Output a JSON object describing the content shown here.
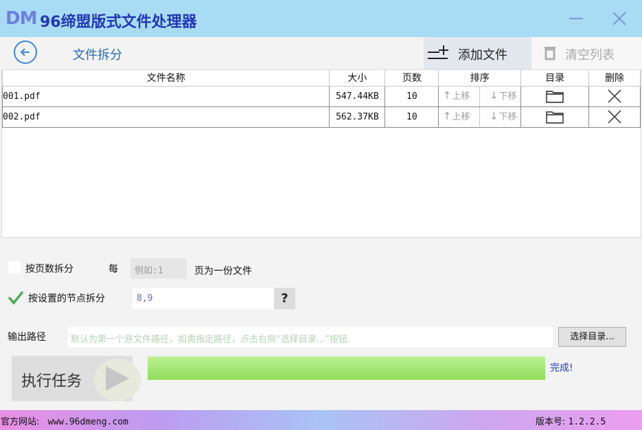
{
  "app": {
    "logo": "DM",
    "title": "96缔盟版式文件处理器",
    "minimize_icon": "minimize-icon",
    "close_icon": "close-icon"
  },
  "toolbar": {
    "back_icon": "arrow-left-circle-icon",
    "page_title": "文件拆分",
    "add_label": "添加文件",
    "add_icon": "add-list-icon",
    "clear_label": "清空列表",
    "clear_icon": "trash-icon"
  },
  "table": {
    "columns": [
      "文件名称",
      "大小",
      "页数",
      "排序",
      "目录",
      "删除"
    ],
    "rows": [
      {
        "name": "001.pdf",
        "size": "547.44KB",
        "pages": "10",
        "up": "上移",
        "down": "下移"
      },
      {
        "name": "002.pdf",
        "size": "562.37KB",
        "pages": "10",
        "up": "上移",
        "down": "下移"
      }
    ]
  },
  "options": {
    "split_by_pages": {
      "label": "按页数拆分",
      "checked": false,
      "every": "每",
      "placeholder": "例如:1",
      "suffix": "页为一份文件"
    },
    "split_by_nodes": {
      "label": "按设置的节点拆分",
      "checked": true,
      "value": "8,9",
      "help": "?"
    }
  },
  "output": {
    "label": "输出路径",
    "placeholder": "默认为第一个原文件路径，如需指定路径，点击右侧“选择目录...”按钮.",
    "choose_button": "选择目录..."
  },
  "run": {
    "label": "执行任务",
    "progress_percent": 100,
    "status": "完成!"
  },
  "footer": {
    "site_label": "官方网站:",
    "site_url": "www.96dmeng.com",
    "version_label": "版本号:",
    "version": "1.2.2.5"
  },
  "colors": {
    "titlebar": "#a8dcf5",
    "title_text": "#2336b5",
    "accent_blue": "#3b87d8",
    "progress_green": "#8fdd59",
    "check_green": "#4caf50"
  }
}
